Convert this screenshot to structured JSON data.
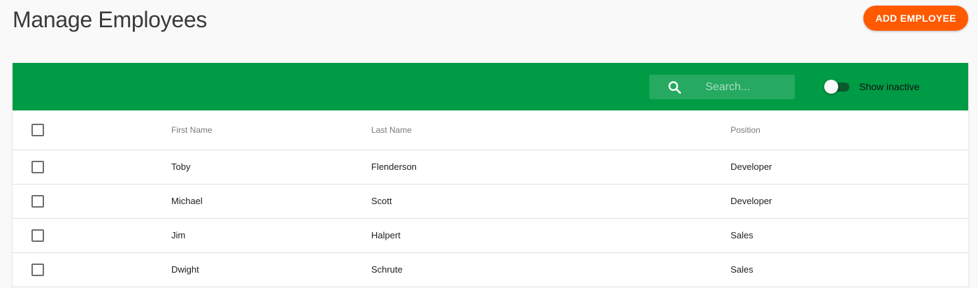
{
  "header": {
    "title": "Manage Employees",
    "add_button_label": "ADD EMPLOYEE"
  },
  "toolbar": {
    "search_placeholder": "Search...",
    "show_inactive_label": "Show inactive",
    "show_inactive": false
  },
  "table": {
    "columns": [
      "First Name",
      "Last Name",
      "Position"
    ],
    "rows": [
      {
        "first": "Toby",
        "last": "Flenderson",
        "position": "Developer"
      },
      {
        "first": "Michael",
        "last": "Scott",
        "position": "Developer"
      },
      {
        "first": "Jim",
        "last": "Halpert",
        "position": "Sales"
      },
      {
        "first": "Dwight",
        "last": "Schrute",
        "position": "Sales"
      }
    ]
  },
  "colors": {
    "accent": "#ff5a00",
    "toolbar": "#009b45"
  },
  "icons": {
    "search": "search-icon"
  }
}
